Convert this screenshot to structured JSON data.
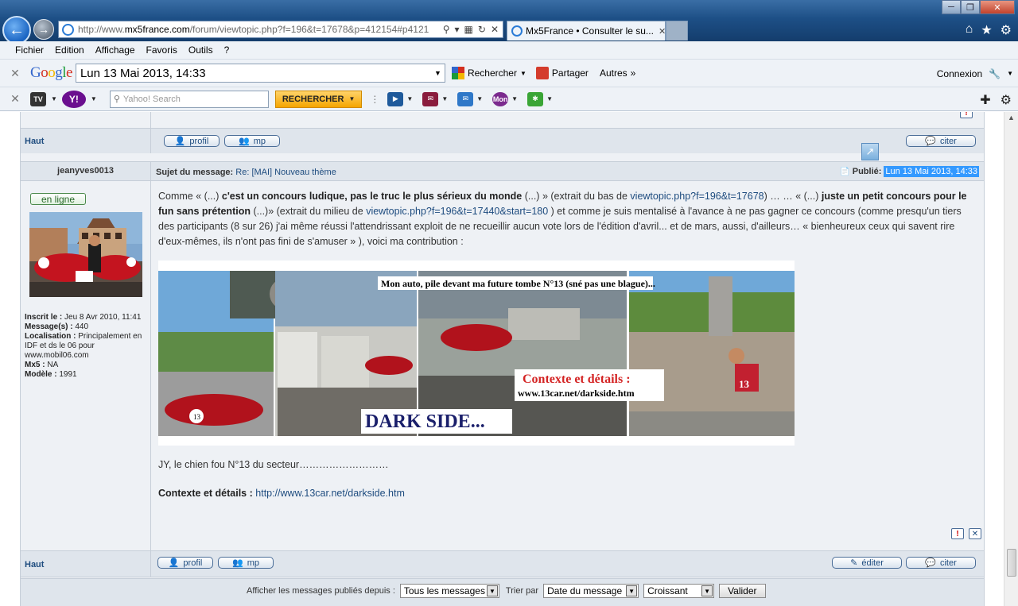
{
  "browser": {
    "url_prefix": "http://www.",
    "url_domain": "mx5france.com",
    "url_rest": "/forum/viewtopic.php?f=196&t=17678&p=412154#p4121",
    "tab_title": "Mx5France • Consulter le su...",
    "menu": [
      "Fichier",
      "Edition",
      "Affichage",
      "Favoris",
      "Outils",
      "?"
    ]
  },
  "google_toolbar": {
    "logo": [
      "G",
      "o",
      "o",
      "g",
      "l",
      "e"
    ],
    "search_value": "Lun 13 Mai 2013, 14:33",
    "search_label": "Rechercher",
    "share_label": "Partager",
    "more_label": "Autres",
    "connect_label": "Connexion"
  },
  "yahoo_toolbar": {
    "search_placeholder": "Yahoo! Search",
    "search_button": "RECHERCHER",
    "mon_label": "Mon"
  },
  "prev_post": {
    "haut": "Haut",
    "profil": "profil",
    "mp": "mp",
    "citer": "citer"
  },
  "post": {
    "author": "jeanyves0013",
    "subject_label": "Sujet du message:",
    "subject": "Re: [MAI] Nouveau thème",
    "published_label": "Publié:",
    "published_date": "Lun 13 Mai 2013, 14:33",
    "online": "en ligne",
    "profile": {
      "registered_label": "Inscrit le :",
      "registered": "Jeu 8 Avr 2010, 11:41",
      "messages_label": "Message(s) :",
      "messages": "440",
      "location_label": "Localisation :",
      "location": "Principalement en IDF et ds le 06 pour www.mobil06.com",
      "mx5_label": "Mx5 :",
      "mx5": "NA",
      "model_label": "Modèle :",
      "model": "1991"
    },
    "message": {
      "p1_a": "Comme « (...) ",
      "p1_b": "c'est un concours ludique, pas le truc le plus sérieux du monde",
      "p1_c": " (...) » (extrait du bas de ",
      "link1": "viewtopic.php?f=196&t=17678",
      "p1_d": ") … … « (...) ",
      "p1_e": "juste un petit concours pour le fun sans prétention",
      "p1_f": " (...)» (extrait du milieu de ",
      "link2": "viewtopic.php?f=196&t=17440&start=180",
      "p1_g": " ) et comme je suis mentalisé à l'avance à ne pas gagner ce concours (comme presqu'un tiers des participants (8 sur 26) j'ai même réussi l'attendrissant exploit de ne recueillir aucun vote lors de l'édition d'avril... et de mars, aussi, d'ailleurs… « bienheureux ceux qui savent rire d'eux-mêmes, ils n'ont pas fini de s'amuser » ), voici ma contribution :"
    },
    "banner": {
      "caption": "Mon auto, pile devant ma future tombe N°13 (sné pas une blague)...",
      "context_title": "Contexte et détails :",
      "context_url": "www.13car.net/darkside.htm",
      "dark_side": "DARK SIDE...",
      "stone_number": "13",
      "car_number": "13",
      "shirt_number": "13"
    },
    "signature": "JY, le chien fou N°13 du secteur………………………",
    "context_label": "Contexte et détails :",
    "context_link": "http://www.13car.net/darkside.htm"
  },
  "actions": {
    "haut": "Haut",
    "profil": "profil",
    "mp": "mp",
    "editer": "éditer",
    "citer": "citer"
  },
  "filter": {
    "show_label": "Afficher les messages publiés depuis :",
    "show_value": "Tous les messages",
    "sort_label": "Trier par",
    "sort_value": "Date du message",
    "order_value": "Croissant",
    "submit": "Valider"
  }
}
